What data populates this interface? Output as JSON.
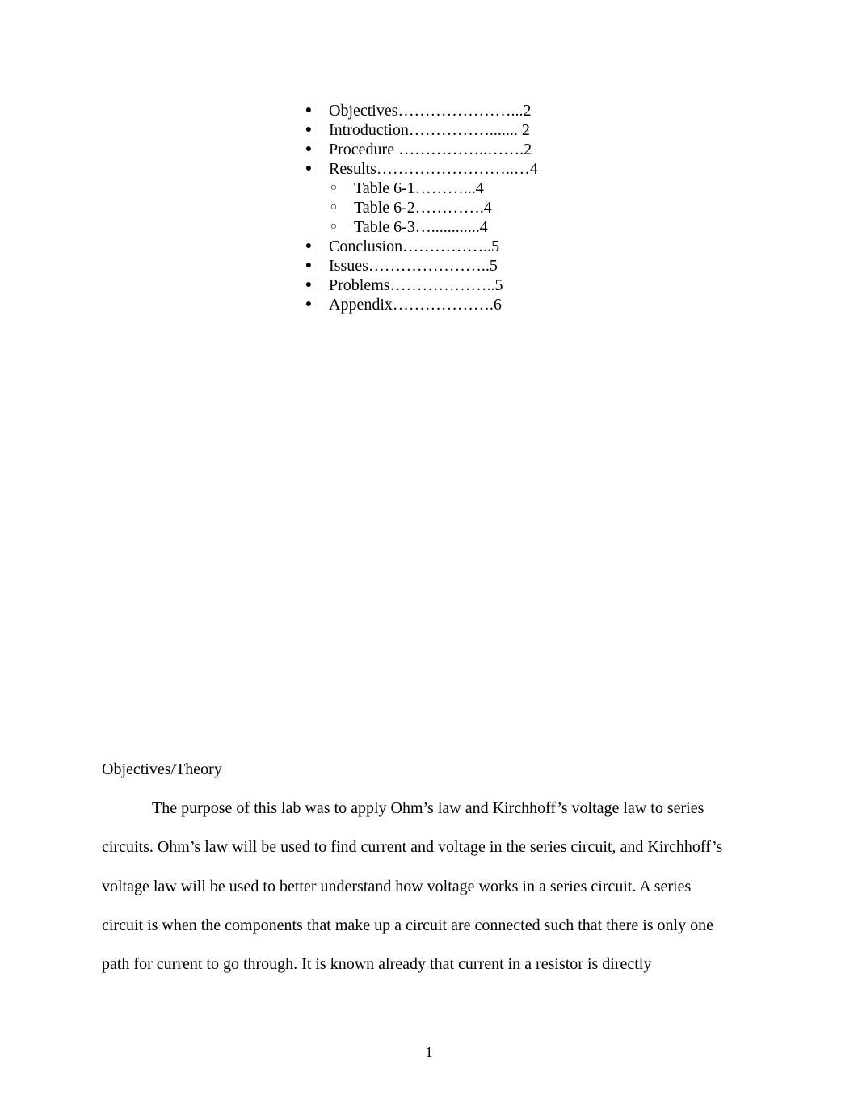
{
  "document": {
    "toc": {
      "items": [
        {
          "level": 1,
          "bullet": "●",
          "label": "Objectives…………………...2"
        },
        {
          "level": 1,
          "bullet": "●",
          "label": "Introduction……………....... 2"
        },
        {
          "level": 1,
          "bullet": "●",
          "label": "Procedure ……………..…….2"
        },
        {
          "level": 1,
          "bullet": "●",
          "label": "Results……………………..…4"
        },
        {
          "level": 2,
          "bullet": "○",
          "label": "Table 6-1………...4"
        },
        {
          "level": 2,
          "bullet": "○",
          "label": "Table 6-2………….4"
        },
        {
          "level": 2,
          "bullet": "○",
          "label": "Table 6-3…............4"
        },
        {
          "level": 1,
          "bullet": "●",
          "label": "Conclusion……………..5"
        },
        {
          "level": 1,
          "bullet": "●",
          "label": "Issues…………………..5"
        },
        {
          "level": 1,
          "bullet": "●",
          "label": "Problems………………..5"
        },
        {
          "level": 1,
          "bullet": "●",
          "label": "Appendix……………….6"
        }
      ]
    },
    "section": {
      "heading": "Objectives/Theory",
      "lines": [
        "The purpose of this lab was to apply Ohm’s law and Kirchhoff’s voltage law to series",
        "circuits. Ohm’s law will be used to find current and voltage in the series circuit, and Kirchhoff’s",
        "voltage law will be used to better understand how voltage works in a series circuit. A series",
        "circuit is when the components that make up a circuit are connected such that there is only one",
        "path for current to go through. It is known already that current in a resistor is directly"
      ]
    },
    "page_number": "1"
  }
}
